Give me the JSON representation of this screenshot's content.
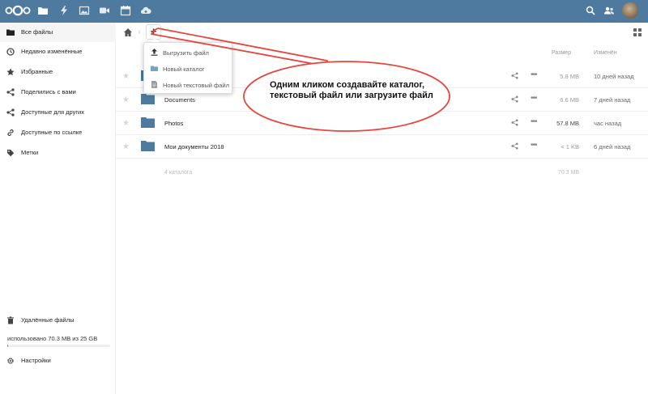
{
  "header": {
    "apps": [
      {
        "name": "files-app-icon",
        "active": true
      },
      {
        "name": "activity-app-icon"
      },
      {
        "name": "gallery-app-icon"
      },
      {
        "name": "video-app-icon"
      },
      {
        "name": "calendar-app-icon"
      },
      {
        "name": "cloud-app-icon"
      }
    ],
    "colors": {
      "bar": "#4f7a9f"
    }
  },
  "sidebar": {
    "items": [
      {
        "label": "Все файлы",
        "icon": "folder-icon"
      },
      {
        "label": "Недавно изменённые",
        "icon": "clock-icon"
      },
      {
        "label": "Избранные",
        "icon": "star-icon"
      },
      {
        "label": "Поделились с вами",
        "icon": "share-icon"
      },
      {
        "label": "Доступные для других",
        "icon": "share-icon"
      },
      {
        "label": "Доступные по ссылке",
        "icon": "link-icon"
      },
      {
        "label": "Метки",
        "icon": "tag-icon"
      }
    ],
    "trash_label": "Удалённые файлы",
    "quota_text": "использовано 70.3 MB из 25 GB",
    "quota_fraction": 0.003,
    "settings_label": "Настройки"
  },
  "files": {
    "columns": {
      "size": "Размер",
      "modified": "Изменён"
    },
    "rows": [
      {
        "name": "",
        "size": "5.8 MB",
        "modified": "10 дней назад"
      },
      {
        "name": "Documents",
        "size": "6.6 MB",
        "modified": "7 дней назад"
      },
      {
        "name": "Photos",
        "size": "57.8 MB",
        "modified": "час назад"
      },
      {
        "name": "Мои документы 2018",
        "size": "< 1 KB",
        "modified": "6 дней назад"
      }
    ],
    "summary": {
      "count": "4 каталога",
      "size": "70.3 MB"
    }
  },
  "new_menu": {
    "add_label": "+",
    "items": [
      {
        "label": "Выгрузить файл",
        "icon": "upload-icon"
      },
      {
        "label": "Новый каталог",
        "icon": "folder-icon"
      },
      {
        "label": "Новый текстовый файл",
        "icon": "text-file-icon"
      }
    ]
  },
  "annotation": {
    "text": "Одним кликом создавайте каталог, текстовый файл или загрузите файл",
    "color": "#e8453c"
  }
}
